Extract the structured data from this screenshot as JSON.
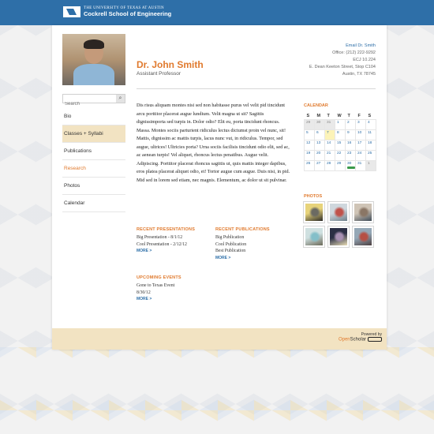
{
  "header": {
    "line1": "THE UNIVERSITY OF TEXAS AT AUSTIN",
    "line2": "Cockrell School of Engineering"
  },
  "search": {
    "placeholder": "Search",
    "button_icon": "search-icon"
  },
  "nav": [
    {
      "label": "Bio",
      "state": "normal"
    },
    {
      "label": "Classes + Syllabi",
      "state": "active"
    },
    {
      "label": "Publications",
      "state": "normal"
    },
    {
      "label": "Research",
      "state": "current"
    },
    {
      "label": "Photos",
      "state": "normal"
    },
    {
      "label": "Calendar",
      "state": "normal"
    }
  ],
  "profile": {
    "name": "Dr. John Smith",
    "title": "Assistant Professor",
    "contact": {
      "email": "Email Dr. Smith",
      "office": "Office: (212) 222-9292",
      "room": "ECJ 10.224",
      "street": "E. Dean Keeton Street, Stop C104",
      "city": "Austin, TX 78745"
    }
  },
  "bio": "Dis risus aliquam montes nisi sed non habitasse purus vel velit pid tincidunt arcu porttitor placerat augue lundium. Velit magna ut sit? Sagittis dignissimporta sed turpis in. Dolor odio? Elit eu, porta tincidunt rhoncus. Massa. Montes sociis parturient ridiculus lectus dictumst proin vel nunc, sit! Mattis, dignissim ac mattis turpis, lacus nunc vut, in ridiculus. Tempor, sed augue, ultrices! Ultricies porta? Urna sociis facilisis tincidunt odio elit, sed ac, ac aenean turpis! Vel aliquet, rhoncus lectus penatibus. Augue velit. Adipiscing. Porttitor placerat rhoncus sagittis ut, quis mattis integer dapibus, eros platea placerat aliquet odio, et! Tortor augue cum augue. Duis nisi, in pid. Mid sed in lorem sed etiam, nec magnis. Elementum, ac dolor ut sit pulvinar.",
  "recent_presentations": {
    "heading": "RECENT PRESENTATIONS",
    "items": [
      "Big Presentation - 8/1/12",
      "Cool Presentation - 2/12/12"
    ],
    "more": "MORE >"
  },
  "recent_publications": {
    "heading": "RECENT PUBLICATIONS",
    "items": [
      "Big Publication",
      "Cool Publication",
      "Best Publication"
    ],
    "more": "MORE >"
  },
  "upcoming_events": {
    "heading": "UPCOMING EVENTS",
    "items": [
      "Gone to Texas Event",
      "8/30/12"
    ],
    "more": "MORE >"
  },
  "calendar": {
    "heading": "CALENDAR",
    "days": [
      "S",
      "M",
      "T",
      "W",
      "T",
      "F",
      "S"
    ],
    "weeks": [
      [
        "29",
        "30",
        "31",
        "1",
        "2",
        "3",
        "4"
      ],
      [
        "5",
        "6",
        "7",
        "8",
        "9",
        "10",
        "11"
      ],
      [
        "12",
        "13",
        "14",
        "15",
        "16",
        "17",
        "18"
      ],
      [
        "19",
        "20",
        "21",
        "22",
        "23",
        "24",
        "25"
      ],
      [
        "26",
        "27",
        "28",
        "29",
        "30",
        "31",
        "1"
      ]
    ],
    "other_month": [
      [
        0,
        0
      ],
      [
        0,
        1
      ],
      [
        0,
        2
      ],
      [
        4,
        6
      ]
    ],
    "today": [
      1,
      2
    ],
    "event": [
      4,
      4
    ],
    "event_color": "#3a9a4a"
  },
  "photos": {
    "heading": "PHOTOS",
    "thumbs": [
      {
        "name": "photo-thumb",
        "colors": [
          "#e7d37a",
          "#6b6a62",
          "#2b2a27"
        ]
      },
      {
        "name": "photo-thumb",
        "colors": [
          "#cfd7dd",
          "#c0524a",
          "#6d7f8a"
        ]
      },
      {
        "name": "photo-thumb",
        "colors": [
          "#cfc4b6",
          "#8a7665",
          "#3f4b57"
        ]
      },
      {
        "name": "photo-thumb",
        "colors": [
          "#cfe0e0",
          "#84bfc9",
          "#6b6a59"
        ]
      },
      {
        "name": "photo-thumb",
        "colors": [
          "#2b2f45",
          "#a790b3",
          "#e9ddb6"
        ]
      },
      {
        "name": "photo-thumb",
        "colors": [
          "#94a7b6",
          "#b64f44",
          "#4c3f40"
        ]
      }
    ]
  },
  "footer": {
    "powered_by": "Powered by",
    "brand_open": "Open",
    "brand_scholar": "Scholar"
  },
  "colors": {
    "primary_blue": "#2e6fa8",
    "accent_orange": "#e07a2e",
    "highlight_tan": "#f2e3c2"
  }
}
